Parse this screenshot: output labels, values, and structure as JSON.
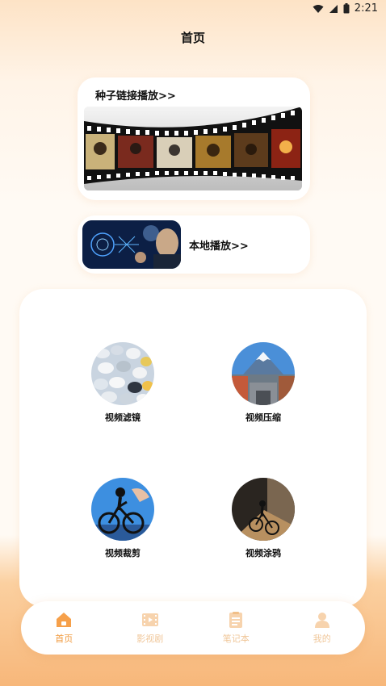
{
  "status_bar": {
    "time": "2:21"
  },
  "header": {
    "title": "首页"
  },
  "torrent_card": {
    "title": "种子链接播放>>"
  },
  "local_card": {
    "title": "本地播放>>"
  },
  "tools": [
    {
      "label": "视频滤镜"
    },
    {
      "label": "视频压缩"
    },
    {
      "label": "视频裁剪"
    },
    {
      "label": "视频涂鸦"
    }
  ],
  "nav": {
    "items": [
      {
        "label": "首页",
        "icon": "home-icon",
        "active": true
      },
      {
        "label": "影视剧",
        "icon": "film-icon",
        "active": false
      },
      {
        "label": "笔记本",
        "icon": "notebook-icon",
        "active": false
      },
      {
        "label": "我的",
        "icon": "profile-icon",
        "active": false
      }
    ]
  },
  "colors": {
    "accent": "#f09a3e",
    "inactive": "#f0c79a",
    "background_top": "#fde3c6",
    "background_bottom": "#f7b77a"
  }
}
